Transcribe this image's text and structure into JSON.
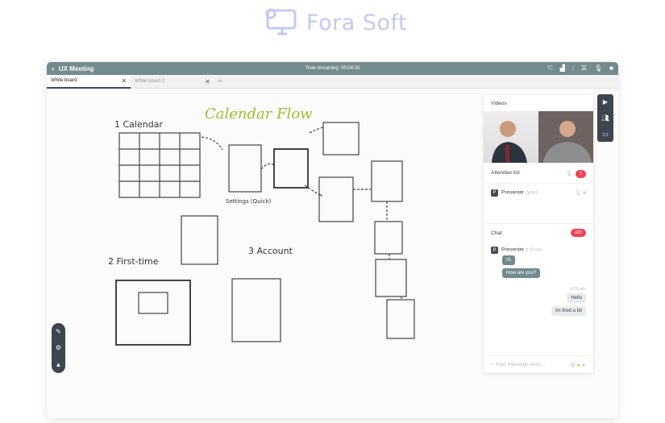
{
  "brand": {
    "name": "Fora Soft",
    "color": "#c3c9f2"
  },
  "titlebar": {
    "title": "UX Meeting",
    "time_remaining": "Time remaining: 00:04:20",
    "icons": [
      "fullscreen-icon",
      "signal-icon",
      "layout-icon",
      "mic-icon",
      "camera-icon"
    ]
  },
  "tabs": [
    {
      "label": "White board",
      "active": true
    },
    {
      "label": "White board 2",
      "active": false
    }
  ],
  "whiteboard": {
    "title": "Calendar Flow",
    "labels": [
      "1 Calendar",
      "2 First-time",
      "3 Account",
      "Settings (Quick)"
    ]
  },
  "panel": {
    "videos_label": "Videos",
    "attendee_label": "Attendee list",
    "attendee_count": "2",
    "presenter_name": "Presenter",
    "presenter_you": "(you)",
    "presenter_initial": "P",
    "chat_label": "Chat",
    "chat_count": "420",
    "messages_in": {
      "sender": "Presenter",
      "time": "4:20 pm",
      "texts": [
        "Hi",
        "How are you?"
      ]
    },
    "messages_out": {
      "time": "4:20 pm",
      "texts": [
        "Hello",
        "Im tired a bit"
      ]
    },
    "input_placeholder": "Your message here..."
  },
  "colors": {
    "titlebar": "#738a8f",
    "badge": "#f2404f",
    "dark": "#3d4550"
  }
}
